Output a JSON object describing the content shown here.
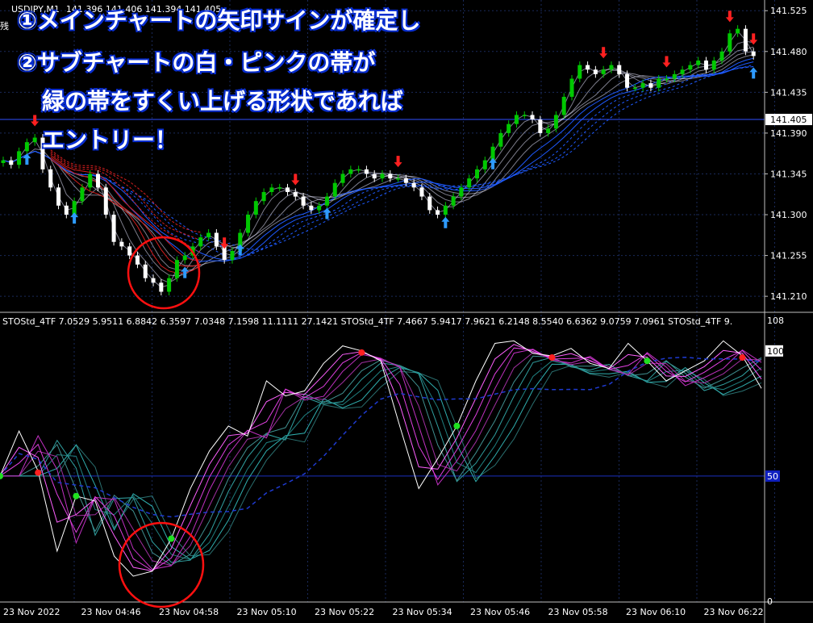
{
  "header": {
    "symbol": "USDJPY,M1",
    "ohlc": "141.396 141.406 141.394 141.405",
    "left_label": "残"
  },
  "overlay_text": {
    "line1": "①メインチャートの矢印サインが確定し",
    "line2": "②サブチャートの白・ピンクの帯が",
    "line3": "緑の帯をすくい上げる形状であれば",
    "line4": "エントリー！"
  },
  "indicator_label": "STOStd_4TF 7.0529 5.9511 6.8842 6.3597 7.0348 7.1598 11.1111 27.1421   STOStd_4TF 7.4667 5.9417 7.9621 6.2148 8.5540 6.6362 9.0759 7.0961   STOStd_4TF 9.",
  "price_axis": {
    "ticks": [
      "141.525",
      "141.480",
      "141.435",
      "141.390",
      "141.345",
      "141.300",
      "141.255",
      "141.210"
    ],
    "current": "141.405"
  },
  "sub_axis": {
    "top": "108",
    "max": "100",
    "mid": "50",
    "min": "0"
  },
  "time_axis": [
    "23 Nov 2022",
    "23 Nov 04:46",
    "23 Nov 04:58",
    "23 Nov 05:10",
    "23 Nov 05:22",
    "23 Nov 05:34",
    "23 Nov 05:46",
    "23 Nov 05:58",
    "23 Nov 06:10",
    "23 Nov 06:22"
  ],
  "colors": {
    "bull": "#00c800",
    "bear": "#ffffff",
    "ribbon_up": "#1e5aff",
    "ribbon_down": "#d21e1e",
    "arrow_up": "#2e9bff",
    "arrow_down": "#ff2020",
    "circle": "#ff1010"
  },
  "chart_data": [
    {
      "type": "candlestick",
      "title": "USDJPY,M1",
      "ylim": [
        141.195,
        141.535
      ],
      "close": [
        141.36,
        141.355,
        141.37,
        141.38,
        141.385,
        141.35,
        141.33,
        141.31,
        141.3,
        141.315,
        141.33,
        141.345,
        141.33,
        141.3,
        141.27,
        141.265,
        141.255,
        141.245,
        141.23,
        141.225,
        141.215,
        141.23,
        141.25,
        141.255,
        141.265,
        141.275,
        141.28,
        141.265,
        141.25,
        141.26,
        141.28,
        141.3,
        141.315,
        141.325,
        141.33,
        141.33,
        141.325,
        141.32,
        141.31,
        141.305,
        141.31,
        141.32,
        141.335,
        141.345,
        141.35,
        141.35,
        141.345,
        141.34,
        141.345,
        141.34,
        141.34,
        141.335,
        141.33,
        141.32,
        141.305,
        141.3,
        141.31,
        141.32,
        141.33,
        141.34,
        141.35,
        141.36,
        141.375,
        141.39,
        141.4,
        141.41,
        141.41,
        141.405,
        141.39,
        141.395,
        141.41,
        141.43,
        141.45,
        141.465,
        141.46,
        141.455,
        141.46,
        141.465,
        141.455,
        141.44,
        141.44,
        141.445,
        141.44,
        141.45,
        141.45,
        141.455,
        141.46,
        141.465,
        141.47,
        141.46,
        141.47,
        141.48,
        141.5,
        141.505,
        141.48,
        141.475
      ]
    },
    {
      "type": "line",
      "title": "STOStd_4TF",
      "ylim": [
        0,
        108
      ],
      "series": [
        {
          "values": [
            50,
            68,
            52,
            20,
            42,
            40,
            18,
            10,
            12,
            25,
            45,
            60,
            70,
            66,
            88,
            82,
            84,
            95,
            102,
            100,
            96,
            70,
            45,
            57,
            70,
            88,
            103,
            104,
            99,
            98,
            101,
            95,
            93,
            103,
            96,
            88,
            92,
            96,
            104,
            98,
            85
          ]
        }
      ]
    }
  ]
}
